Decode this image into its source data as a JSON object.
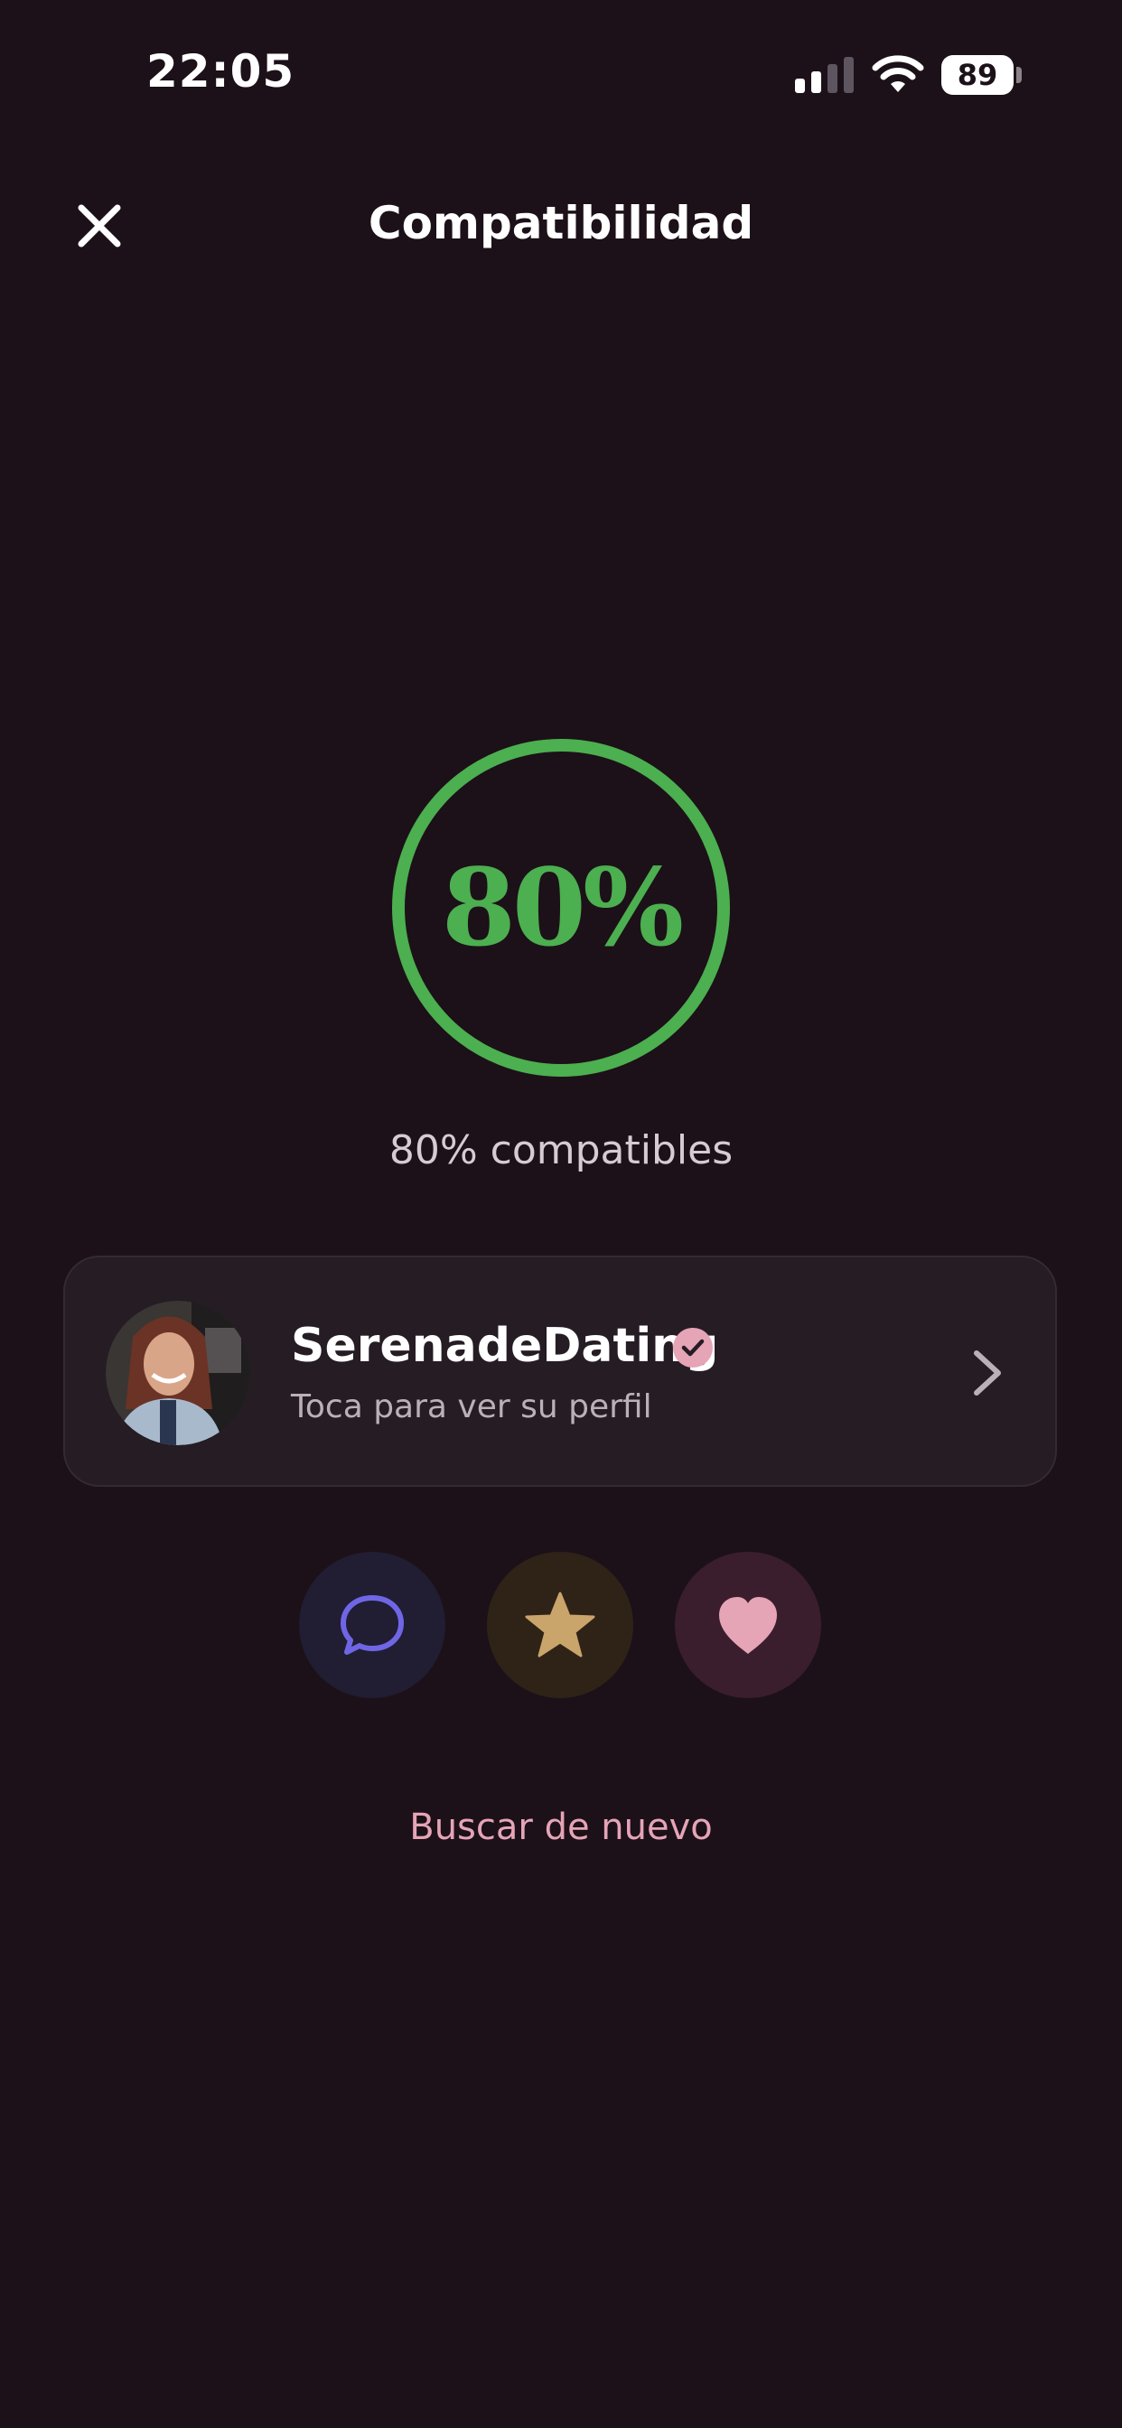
{
  "status_bar": {
    "time": "22:05",
    "battery": "89",
    "icons": [
      "cellular-signal-icon",
      "wifi-icon",
      "battery-icon"
    ]
  },
  "header": {
    "title": "Compatibilidad",
    "close_icon": "close-icon"
  },
  "compatibility": {
    "score_text": "80%",
    "score_value": 80,
    "caption": "80% compatibles"
  },
  "profile_card": {
    "name": "SerenadeDating",
    "subtitle": "Toca para ver su perfil",
    "verified": true,
    "icons": [
      "verified-check-icon",
      "chevron-right-icon"
    ]
  },
  "actions": [
    {
      "name": "chat",
      "icon": "chat-bubble-icon"
    },
    {
      "name": "super-like",
      "icon": "star-icon"
    },
    {
      "name": "like",
      "icon": "heart-icon"
    }
  ],
  "footer": {
    "search_again": "Buscar de nuevo"
  },
  "colors": {
    "background": "#1c1118",
    "accent_green": "#4caf50",
    "accent_pink": "#e6a4b7",
    "chat_purple": "#6f66e6",
    "star_gold": "#c9a46b",
    "card_background": "#251c24"
  }
}
